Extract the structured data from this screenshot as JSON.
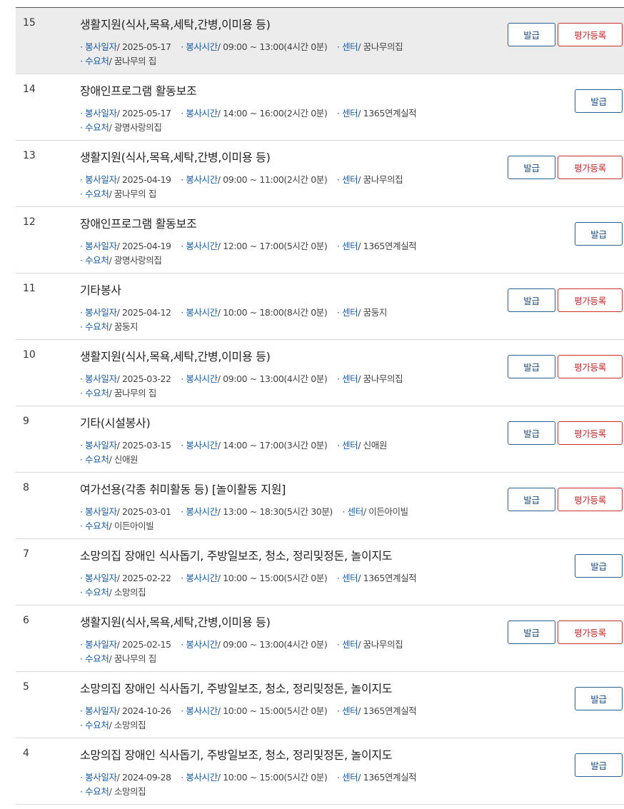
{
  "labels": {
    "date": "봉사일자",
    "time": "봉사시간",
    "center": "센터",
    "recipient": "수요처",
    "issue": "발급",
    "evaluate": "평가등록"
  },
  "rows": [
    {
      "num": "15",
      "title": "생활지원(식사,목욕,세탁,간병,이미용 등)",
      "date": "2025-05-17",
      "time": "09:00 ~ 13:00(4시간 0분)",
      "center": "꿈나무의집",
      "recipient": "꿈나무의 집",
      "eval": true,
      "highlight": true
    },
    {
      "num": "14",
      "title": "장애인프로그램 활동보조",
      "date": "2025-05-17",
      "time": "14:00 ~ 16:00(2시간 0분)",
      "center": "1365연계실적",
      "recipient": "광명사랑의집",
      "eval": false,
      "highlight": false
    },
    {
      "num": "13",
      "title": "생활지원(식사,목욕,세탁,간병,이미용 등)",
      "date": "2025-04-19",
      "time": "09:00 ~ 11:00(2시간 0분)",
      "center": "꿈나무의집",
      "recipient": "꿈나무의 집",
      "eval": true,
      "highlight": false
    },
    {
      "num": "12",
      "title": "장애인프로그램 활동보조",
      "date": "2025-04-19",
      "time": "12:00 ~ 17:00(5시간 0분)",
      "center": "1365연계실적",
      "recipient": "광명사랑의집",
      "eval": false,
      "highlight": false
    },
    {
      "num": "11",
      "title": "기타봉사",
      "date": "2025-04-12",
      "time": "10:00 ~ 18:00(8시간 0분)",
      "center": "꿈둥지",
      "recipient": "꿈둥지",
      "eval": true,
      "highlight": false
    },
    {
      "num": "10",
      "title": "생활지원(식사,목욕,세탁,간병,이미용 등)",
      "date": "2025-03-22",
      "time": "09:00 ~ 13:00(4시간 0분)",
      "center": "꿈나무의집",
      "recipient": "꿈나무의 집",
      "eval": true,
      "highlight": false
    },
    {
      "num": "9",
      "title": "기타(시설봉사)",
      "date": "2025-03-15",
      "time": "14:00 ~ 17:00(3시간 0분)",
      "center": "신애원",
      "recipient": "신애원",
      "eval": true,
      "highlight": false
    },
    {
      "num": "8",
      "title": "여가선용(각종 취미활동 등) [놀이활동 지원]",
      "date": "2025-03-01",
      "time": "13:00 ~ 18:30(5시간 30분)",
      "center": "이든아이빌",
      "recipient": "이든아이빌",
      "eval": true,
      "highlight": false
    },
    {
      "num": "7",
      "title": "소망의집 장애인 식사돕기, 주방일보조, 청소, 정리밎정돈, 놀이지도",
      "date": "2025-02-22",
      "time": "10:00 ~ 15:00(5시간 0분)",
      "center": "1365연계실적",
      "recipient": "소망의집",
      "eval": false,
      "highlight": false
    },
    {
      "num": "6",
      "title": "생활지원(식사,목욕,세탁,간병,이미용 등)",
      "date": "2025-02-15",
      "time": "09:00 ~ 13:00(4시간 0분)",
      "center": "꿈나무의집",
      "recipient": "꿈나무의 집",
      "eval": true,
      "highlight": false
    },
    {
      "num": "5",
      "title": "소망의집 장애인 식사돕기, 주방일보조, 청소, 정리밎정돈, 놀이지도",
      "date": "2024-10-26",
      "time": "10:00 ~ 15:00(5시간 0분)",
      "center": "1365연계실적",
      "recipient": "소망의집",
      "eval": false,
      "highlight": false
    },
    {
      "num": "4",
      "title": "소망의집 장애인 식사돕기, 주방일보조, 청소, 정리밎정돈, 놀이지도",
      "date": "2024-09-28",
      "time": "10:00 ~ 15:00(5시간 0분)",
      "center": "1365연계실적",
      "recipient": "소망의집",
      "eval": false,
      "highlight": false
    }
  ]
}
